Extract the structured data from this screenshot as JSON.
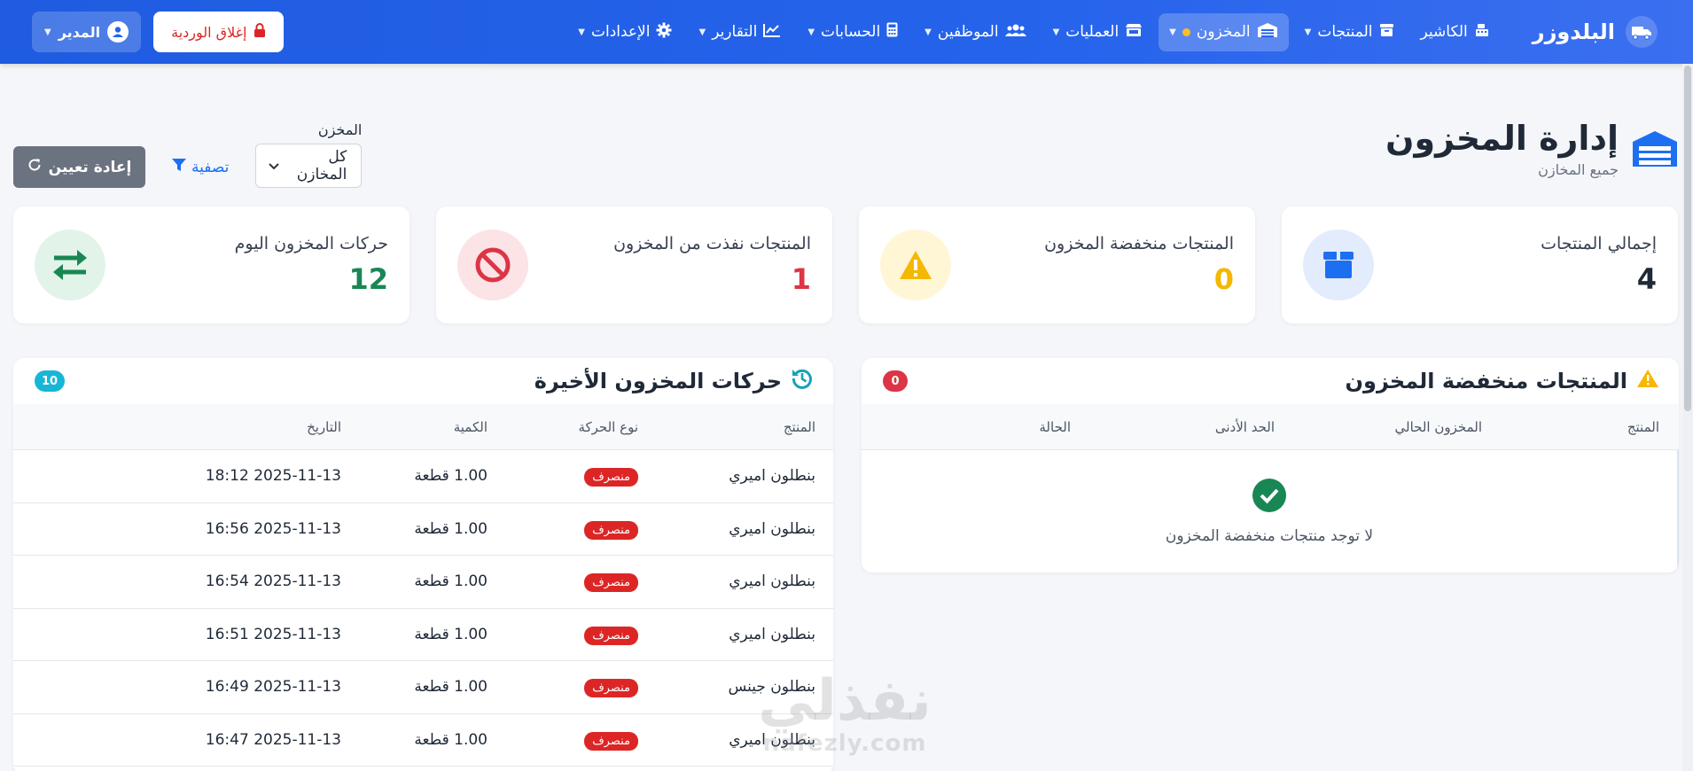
{
  "nav": {
    "brand": "البلدوزر",
    "items": [
      {
        "label": "الكاشير",
        "icon": "cash-register-icon"
      },
      {
        "label": "المنتجات",
        "icon": "box-icon"
      },
      {
        "label": "المخزون",
        "icon": "warehouse-icon"
      },
      {
        "label": "العمليات",
        "icon": "store-icon"
      },
      {
        "label": "الموظفين",
        "icon": "users-icon"
      },
      {
        "label": "الحسابات",
        "icon": "calculator-icon"
      },
      {
        "label": "التقارير",
        "icon": "chart-line-icon"
      },
      {
        "label": "الإعدادات",
        "icon": "gear-icon"
      }
    ],
    "close_shift": "إغلاق الوردية",
    "user": "المدير"
  },
  "page": {
    "title": "إدارة المخزون",
    "subtitle": "جميع المخازن"
  },
  "filters": {
    "warehouse_label": "المخزن",
    "warehouse_value": "كل المخازن",
    "filter_label": "تصفية",
    "reset_label": "إعادة تعيين"
  },
  "stats": [
    {
      "label": "إجمالي المنتجات",
      "value": "4",
      "color": "#1f2937",
      "icon": "box-icon"
    },
    {
      "label": "المنتجات منخفضة المخزون",
      "value": "0",
      "color": "#f5b800",
      "icon": "warning-icon"
    },
    {
      "label": "المنتجات نفذت من المخزون",
      "value": "1",
      "color": "#dc3545",
      "icon": "ban-icon"
    },
    {
      "label": "حركات المخزون اليوم",
      "value": "12",
      "color": "#198754",
      "icon": "exchange-icon"
    }
  ],
  "low_stock": {
    "title": "المنتجات منخفضة المخزون",
    "count": "0",
    "columns": [
      "المنتج",
      "المخزون الحالي",
      "الحد الأدنى",
      "الحالة"
    ],
    "empty_message": "لا توجد منتجات منخفضة المخزون"
  },
  "movements": {
    "title": "حركات المخزون الأخيرة",
    "count": "10",
    "columns": [
      "المنتج",
      "نوع الحركة",
      "الكمية",
      "التاريخ"
    ],
    "rows": [
      {
        "product": "بنطلون اميري",
        "type": "منصرف",
        "qty": "1.00 قطعة",
        "date": "2025-11-13 18:12"
      },
      {
        "product": "بنطلون اميري",
        "type": "منصرف",
        "qty": "1.00 قطعة",
        "date": "2025-11-13 16:56"
      },
      {
        "product": "بنطلون اميري",
        "type": "منصرف",
        "qty": "1.00 قطعة",
        "date": "2025-11-13 16:54"
      },
      {
        "product": "بنطلون اميري",
        "type": "منصرف",
        "qty": "1.00 قطعة",
        "date": "2025-11-13 16:51"
      },
      {
        "product": "بنطلون جينس",
        "type": "منصرف",
        "qty": "1.00 قطعة",
        "date": "2025-11-13 16:49"
      },
      {
        "product": "بنطلون اميري",
        "type": "منصرف",
        "qty": "1.00 قطعة",
        "date": "2025-11-13 16:47"
      }
    ]
  },
  "watermark": {
    "arabic": "نفذلي",
    "latin": "nafezly.com"
  }
}
